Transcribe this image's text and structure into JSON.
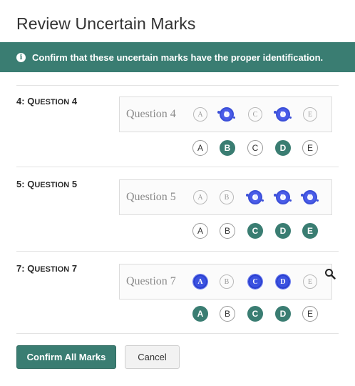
{
  "dialog": {
    "title": "Review Uncertain Marks",
    "banner_text": "Confirm that these uncertain marks have the proper identification.",
    "info_icon": "i"
  },
  "questions": [
    {
      "number": "4:",
      "label_first": "Q",
      "label_rest": "UESTION",
      "label_num": "4",
      "scan_text": "Question 4",
      "bubbles": [
        "A",
        "B",
        "C",
        "D",
        "E"
      ],
      "selected": [
        "B",
        "D"
      ]
    },
    {
      "number": "5:",
      "label_first": "Q",
      "label_rest": "UESTION",
      "label_num": "5",
      "scan_text": "Question 5",
      "bubbles": [
        "A",
        "B",
        "C",
        "D",
        "E"
      ],
      "selected": [
        "C",
        "D",
        "E"
      ]
    },
    {
      "number": "7:",
      "label_first": "Q",
      "label_rest": "UESTION",
      "label_num": "7",
      "scan_text": "Question 7",
      "bubbles": [
        "A",
        "B",
        "C",
        "D",
        "E"
      ],
      "selected": [
        "A",
        "C",
        "D"
      ]
    }
  ],
  "buttons": {
    "confirm": "Confirm All Marks",
    "cancel": "Cancel"
  },
  "colors": {
    "accent": "#3a7d72",
    "scan_ink": "#3b4fd8"
  }
}
